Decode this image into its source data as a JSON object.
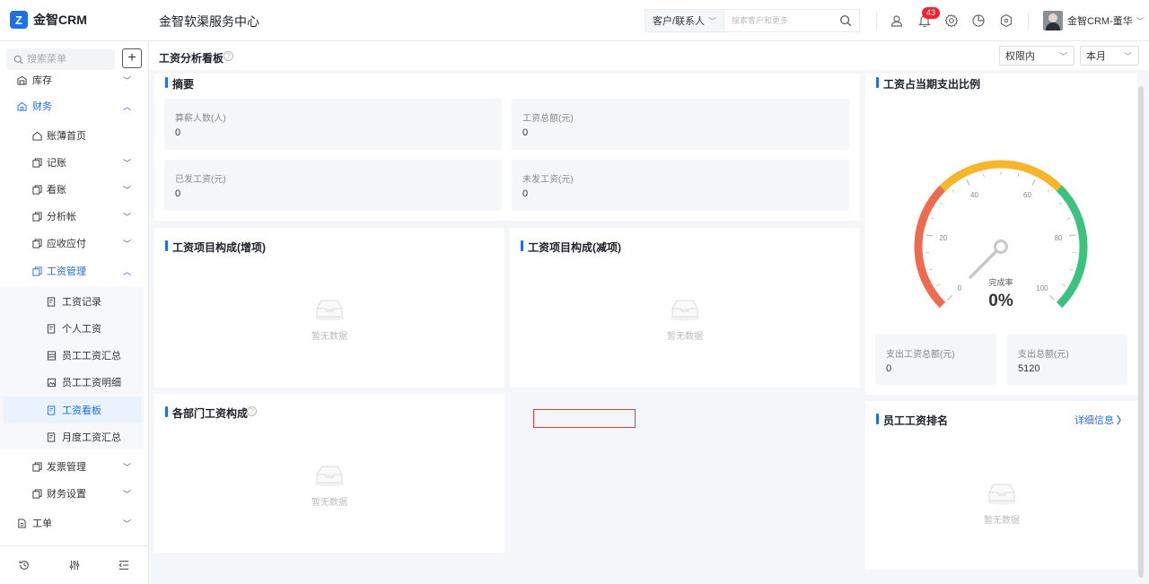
{
  "header": {
    "logo_text": "金智CRM",
    "center_title": "金智软渠服务中心",
    "search_type": "客户/联系人",
    "search_placeholder": "搜索客户和更多",
    "notification_count": "43",
    "user_name": "金智CRM-董华"
  },
  "sidebar": {
    "search_placeholder": "搜索菜单",
    "items": [
      {
        "label": "库存"
      },
      {
        "label": "财务"
      },
      {
        "label": "账薄首页"
      },
      {
        "label": "记账"
      },
      {
        "label": "看账"
      },
      {
        "label": "分析帐"
      },
      {
        "label": "应收应付"
      },
      {
        "label": "工资管理"
      },
      {
        "label": "工资记录"
      },
      {
        "label": "个人工资"
      },
      {
        "label": "员工工资汇总"
      },
      {
        "label": "员工工资明细"
      },
      {
        "label": "工资看板"
      },
      {
        "label": "月度工资汇总"
      },
      {
        "label": "发票管理"
      },
      {
        "label": "财务设置"
      },
      {
        "label": "工单"
      }
    ]
  },
  "page": {
    "title": "工资分析看板",
    "filter_scope": "权限内",
    "filter_period": "本月"
  },
  "summary": {
    "title": "摘要",
    "stats": [
      {
        "label": "算薪人数(人)",
        "value": "0"
      },
      {
        "label": "工资总额(元)",
        "value": "0"
      },
      {
        "label": "已发工资(元)",
        "value": "0"
      },
      {
        "label": "未发工资(元)",
        "value": "0"
      }
    ]
  },
  "gauge": {
    "title": "工资占当期支出比例",
    "ticks": [
      "0",
      "20",
      "40",
      "60",
      "80",
      "100"
    ],
    "label": "完成率",
    "value_text": "0%",
    "value": 0,
    "colors": {
      "low": "#ee6a50",
      "mid": "#f7b52c",
      "high": "#3cc27e"
    },
    "stats": [
      {
        "label": "支出工资总额(元)",
        "value": "0"
      },
      {
        "label": "支出总额(元)",
        "value": "5120"
      }
    ]
  },
  "increase": {
    "title": "工资项目构成(增项)",
    "empty_text": "暂无数据"
  },
  "decrease": {
    "title": "工资项目构成(减项)",
    "empty_text": "暂无数据"
  },
  "department": {
    "title": "各部门工资构成",
    "empty_text": "暂无数据"
  },
  "ranking": {
    "title": "员工工资排名",
    "detail_link": "详细信息",
    "empty_text": "暂无数据"
  }
}
